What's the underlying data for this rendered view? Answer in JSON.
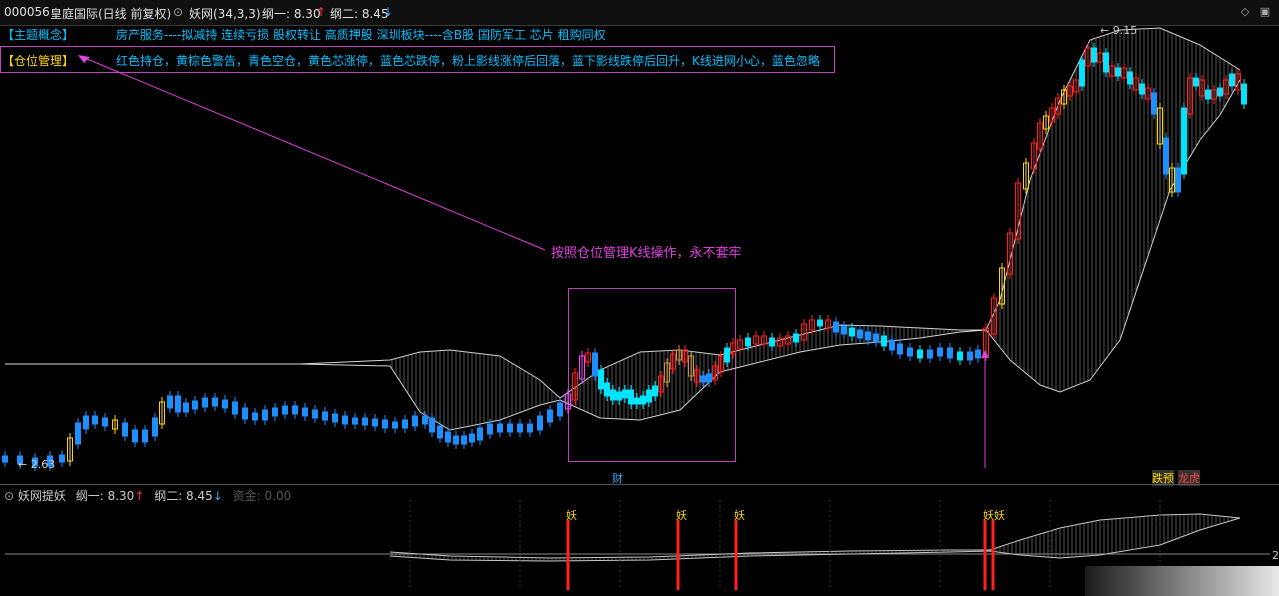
{
  "header": {
    "stock_code": "000056",
    "stock_name": "皇庭国际",
    "period": "(日线 前复权)",
    "indicator": "妖网(34,3,3)",
    "line1_label": "纲一: 8.30",
    "line1_arrow": "↑",
    "line2_label": "纲二: 8.45",
    "line2_arrow": "↓"
  },
  "concept": {
    "tag": "【主题概念】",
    "text": "房产服务----拟减持 连续亏损 股权转让 高质押股 深圳板块----含B股 国防军工 芯片 租购同权"
  },
  "position": {
    "tag": "【仓位管理】",
    "text": "红色持仓，黄棕色警告，青色空仓，黄色芯涨停，蓝色芯跌停，粉上影线涨停后回落，蓝下影线跌停后回升，K线进网小心，蓝色忽略"
  },
  "annotation": "按照仓位管理K线操作，永不套牢",
  "price_labels": {
    "high": "9.15",
    "low": "2.63"
  },
  "event_labels": {
    "cai": "财",
    "event1": "跌预",
    "event2": "龙虎"
  },
  "indicator_panel": {
    "title": "妖网提妖",
    "line1_label": "纲一: 8.30",
    "line1_arrow": "↑",
    "line2_label": "纲二: 8.45",
    "line2_arrow": "↓",
    "extra": "资金: 0.00",
    "signal_char": "妖",
    "right_edge_label": "2"
  },
  "colors": {
    "red": "#ff2020",
    "cyan": "#00e5ff",
    "blue": "#1e8fff",
    "yellow": "#ffd700",
    "brown": "#c8963c",
    "magenta": "#e040e0",
    "net": "#d8d8d8"
  }
}
